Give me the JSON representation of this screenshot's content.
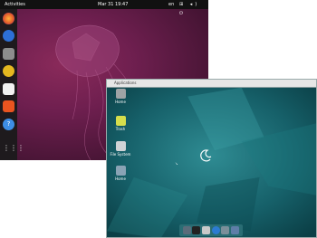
{
  "ubuntu": {
    "topbar": {
      "activities": "Activities",
      "clock": "Mar 31  19:47",
      "lang": "en",
      "tray": "⊞ ◂) ⏻"
    },
    "dock_icons": [
      "firefox-icon",
      "thunderbird-icon",
      "files-icon",
      "rhythmbox-icon",
      "writer-icon",
      "software-icon",
      "help-icon",
      "apps-grid-icon"
    ]
  },
  "debian": {
    "title": "Applications",
    "desktop_icons": [
      {
        "label": "Home",
        "icon": "home-folder-icon"
      },
      {
        "label": "Trash",
        "icon": "trash-icon"
      },
      {
        "label": "File System",
        "icon": "filesystem-icon"
      },
      {
        "label": "Home",
        "icon": "home-icon"
      }
    ]
  },
  "colors": {
    "ubuntu_bg": "#6e1f4f",
    "debian_bg": "#0f4f57",
    "dock": "#1e1a1d"
  }
}
